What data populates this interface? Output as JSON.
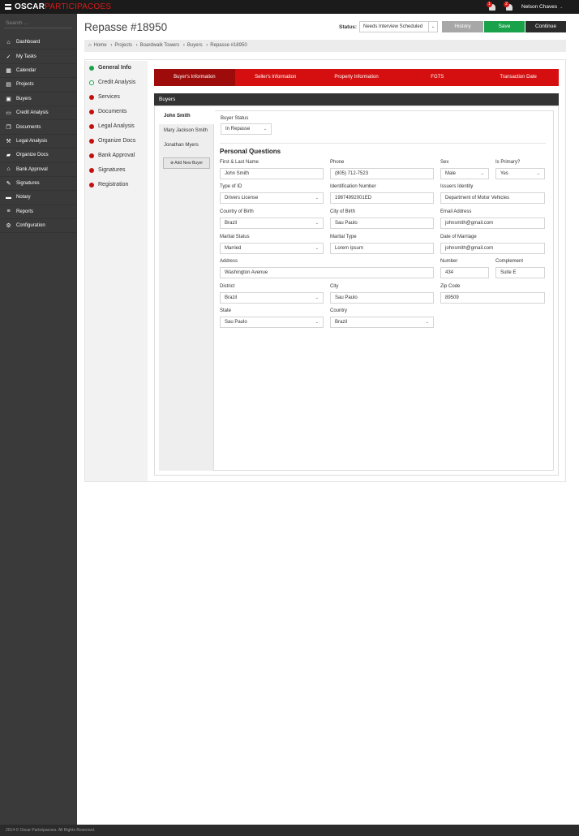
{
  "app": {
    "brand_primary": "OSCAR",
    "brand_secondary": "PARTICIPACOES",
    "user_name": "Nelson Chaves",
    "notifications": [
      "1",
      "2"
    ],
    "search_placeholder": "Search ...",
    "footer": "2014 © Oscar Participacoes.  All Rights Reserved."
  },
  "sidebar": {
    "items": [
      {
        "label": "Dashboard",
        "icon": "home-icon"
      },
      {
        "label": "My Tasks",
        "icon": "check-icon"
      },
      {
        "label": "Calendar",
        "icon": "calendar-icon"
      },
      {
        "label": "Projects",
        "icon": "document-icon"
      },
      {
        "label": "Buyers",
        "icon": "briefcase-icon"
      },
      {
        "label": "Credit Analysis",
        "icon": "credit-card-icon"
      },
      {
        "label": "Documents",
        "icon": "copy-icon"
      },
      {
        "label": "Legal Analysis",
        "icon": "gavel-icon"
      },
      {
        "label": "Organize Docs",
        "icon": "folder-icon"
      },
      {
        "label": "Bank Approval",
        "icon": "bank-icon"
      },
      {
        "label": "Signatures",
        "icon": "pencil-icon"
      },
      {
        "label": "Notary",
        "icon": "inbox-icon"
      },
      {
        "label": "Reports",
        "icon": "list-icon"
      },
      {
        "label": "Configuration",
        "icon": "gear-icon"
      }
    ]
  },
  "header": {
    "title": "Repasse #18950",
    "status_label": "Status:",
    "status_value": "Needs Interview Scheduled",
    "history_label": "History",
    "save_label": "Save",
    "continue_label": "Continue",
    "breadcrumb": [
      "Home",
      "Projects",
      "Boardwalk Towers",
      "Buyers",
      "Repasse #18950"
    ]
  },
  "steps": [
    {
      "label": "General Info",
      "state": "current"
    },
    {
      "label": "Credit Analysis",
      "state": "pending"
    },
    {
      "label": "Services",
      "state": "todo"
    },
    {
      "label": "Documents",
      "state": "todo"
    },
    {
      "label": "Legal Analysis",
      "state": "todo"
    },
    {
      "label": "Organize Docs",
      "state": "todo"
    },
    {
      "label": "Bank Approval",
      "state": "todo"
    },
    {
      "label": "Signatures",
      "state": "todo"
    },
    {
      "label": "Registration",
      "state": "todo"
    }
  ],
  "tabs": [
    "Buyer's Information",
    "Seller's Information",
    "Property Information",
    "FGTS",
    "Transaction Date"
  ],
  "section_title": "Buyers",
  "buyers": [
    "John Smith",
    "Mary Jackson Smith",
    "Jonathan Myers"
  ],
  "add_buyer_label": "Add New Buyer",
  "buyer_status": {
    "label": "Buyer Status",
    "value": "In Repasse"
  },
  "personal_questions": {
    "title": "Personal Questions",
    "name": {
      "label": "First & Last Name",
      "value": "John Smith"
    },
    "phone": {
      "label": "Phone",
      "value": "(805) 712-7523"
    },
    "sex": {
      "label": "Sex",
      "value": "Male"
    },
    "is_primary": {
      "label": "Is Primary?",
      "value": "Yes"
    },
    "type_of_id": {
      "label": "Type of ID",
      "value": "Drivers License"
    },
    "id_number": {
      "label": "Identification Number",
      "value": "19874992001ED"
    },
    "issuers_identity": {
      "label": "Issuers Identity",
      "value": "Department of Motor Vehicles"
    },
    "country_of_birth": {
      "label": "Country of Birth",
      "value": "Brazil"
    },
    "city_of_birth": {
      "label": "City of Birth",
      "value": "Sau Paulo"
    },
    "email": {
      "label": "Email Address",
      "value": "johnsmith@gmail.com"
    },
    "marital_status": {
      "label": "Marital Status",
      "value": "Married"
    },
    "marital_type": {
      "label": "Marital Type",
      "value": "Lorem Ipsum"
    },
    "date_of_marriage": {
      "label": "Date of Marriage",
      "value": "johnsmith@gmail.com"
    },
    "address": {
      "label": "Address",
      "value": "Washington Avenue"
    },
    "number": {
      "label": "Number",
      "value": "434"
    },
    "complement": {
      "label": "Complement",
      "value": "Suite E"
    },
    "district": {
      "label": "District",
      "value": "Brazil"
    },
    "city": {
      "label": "City",
      "value": "Sau Paulo"
    },
    "zip": {
      "label": "Zip Code",
      "value": "89509"
    },
    "state": {
      "label": "State",
      "value": "Sau Paulo"
    },
    "country": {
      "label": "Country",
      "value": "Brazil"
    }
  },
  "colors": {
    "accent_red": "#d50f0f",
    "active_tab": "#9e0b0b",
    "save_green": "#1aa24a",
    "sidebar_bg": "#3a3a3a",
    "topbar_bg": "#1b1b1b"
  }
}
